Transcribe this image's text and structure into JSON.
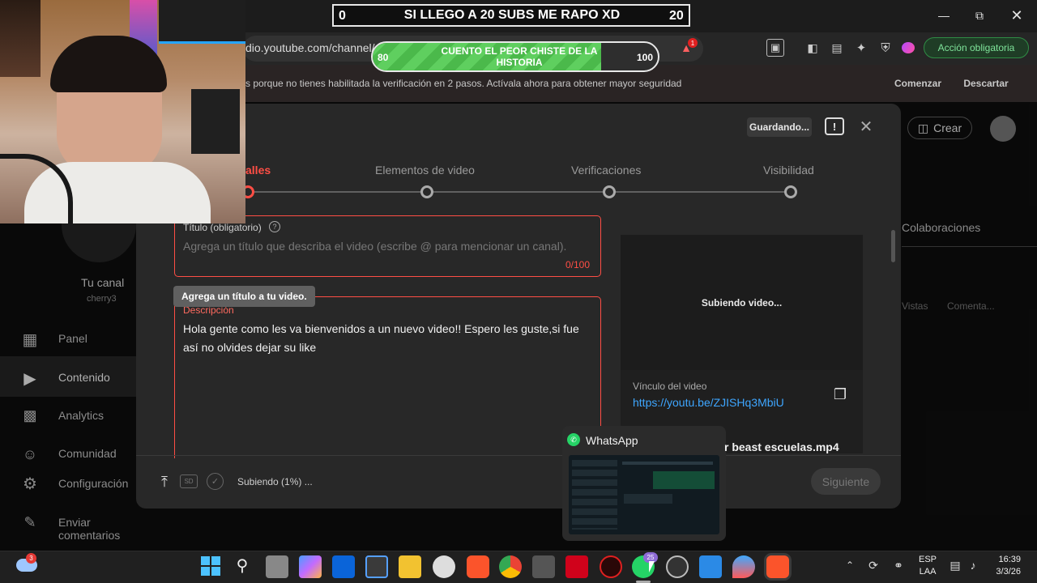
{
  "overlay": {
    "subs_left": "0",
    "subs_title": "SI LLEGO A 20 SUBS ME RAPO XD",
    "subs_right": "20",
    "pill_left": "80",
    "pill_text": "CUENTO EL PEOR CHISTE DE LA HISTORIA",
    "pill_right": "100"
  },
  "browser": {
    "url": "dio.youtube.com/channel/",
    "action_button": "Acción obligatoria",
    "notice_text": "s porque no tienes habilitada la verificación en 2 pasos. Actívala ahora para obtener mayor seguridad",
    "notice_start": "Comenzar",
    "notice_dismiss": "Descartar",
    "ext_badge": "1"
  },
  "studio": {
    "create_label": "Crear",
    "channel_label": "Tu canal",
    "channel_handle": "cherry3",
    "collab_tab": "Colaboraciones",
    "col_views": "Vistas",
    "col_comments": "Comenta...",
    "sidebar": [
      {
        "label": "Panel",
        "icon": "dashboard-icon"
      },
      {
        "label": "Contenido",
        "icon": "content-icon"
      },
      {
        "label": "Analytics",
        "icon": "analytics-icon"
      },
      {
        "label": "Comunidad",
        "icon": "community-icon"
      },
      {
        "label": "Configuración",
        "icon": "gear-icon"
      },
      {
        "label": "Enviar comentarios",
        "icon": "feedback-icon"
      }
    ]
  },
  "modal": {
    "saving_badge": "Guardando...",
    "steps": [
      "alles",
      "Elementos de video",
      "Verificaciones",
      "Visibilidad"
    ],
    "title_label": "Título (obligatorio)",
    "title_placeholder": "Agrega un título que describa el video (escribe @ para mencionar un canal).",
    "title_counter": "0/100",
    "title_tooltip": "Agrega un título a tu video.",
    "desc_label": "Descripción",
    "desc_value": "Hola gente como les va bienvenidos a un nuevo video!! Espero les guste,si fue así no olvides dejar su like",
    "preview_status": "Subiendo video...",
    "link_label": "Vínculo del video",
    "link_url": "https://youtu.be/ZJISHq3MbiU",
    "filename": "r beast escuelas.mp4",
    "upload_status": "Subiendo (1%) ...",
    "hd_badge": "SD",
    "next_button": "Siguiente"
  },
  "whatsapp_preview": {
    "title": "WhatsApp"
  },
  "taskbar": {
    "weather_badge": "3",
    "whatsapp_badge": "25",
    "lang_top": "ESP",
    "lang_bottom": "LAA",
    "time": "16:39",
    "date": "3/3/26"
  },
  "colors": {
    "youtube_red": "#ff4e45",
    "link_blue": "#3ea6ff",
    "pill_green": "#5fcf5f",
    "action_green": "#1f8a3d"
  }
}
